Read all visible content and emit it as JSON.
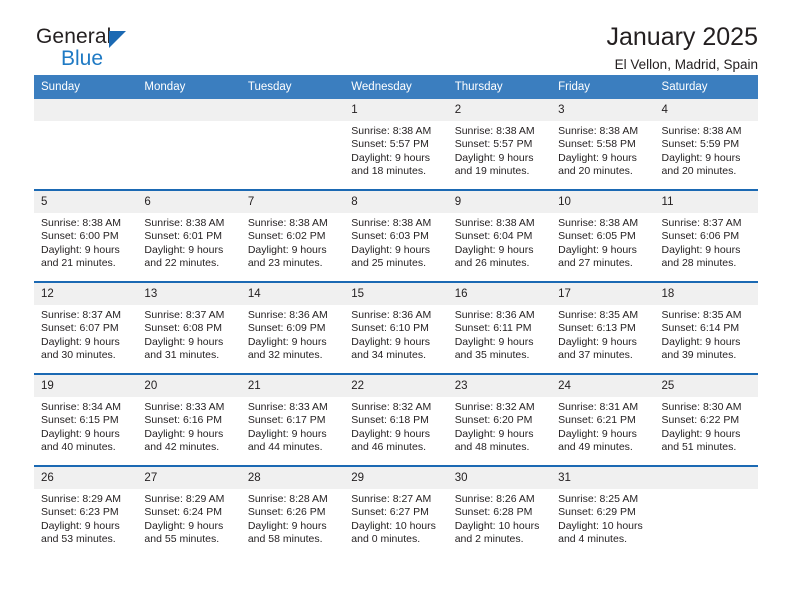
{
  "brand": {
    "line1": "General",
    "line2": "Blue",
    "triangle_color": "#1b69b3",
    "blue_color": "#1f7ac4"
  },
  "header": {
    "title": "January 2025",
    "subtitle": "El Vellon, Madrid, Spain"
  },
  "theme": {
    "header_bg": "#3b7ebf",
    "row_rule": "#1b69b3",
    "daynum_bg": "#f0f0f0",
    "text": "#231f20"
  },
  "weekdays": [
    "Sunday",
    "Monday",
    "Tuesday",
    "Wednesday",
    "Thursday",
    "Friday",
    "Saturday"
  ],
  "weeks": [
    [
      {
        "day": "",
        "sunrise": "",
        "sunset": "",
        "daylight_line1": "",
        "daylight_line2": ""
      },
      {
        "day": "",
        "sunrise": "",
        "sunset": "",
        "daylight_line1": "",
        "daylight_line2": ""
      },
      {
        "day": "",
        "sunrise": "",
        "sunset": "",
        "daylight_line1": "",
        "daylight_line2": ""
      },
      {
        "day": "1",
        "sunrise": "Sunrise: 8:38 AM",
        "sunset": "Sunset: 5:57 PM",
        "daylight_line1": "Daylight: 9 hours",
        "daylight_line2": "and 18 minutes."
      },
      {
        "day": "2",
        "sunrise": "Sunrise: 8:38 AM",
        "sunset": "Sunset: 5:57 PM",
        "daylight_line1": "Daylight: 9 hours",
        "daylight_line2": "and 19 minutes."
      },
      {
        "day": "3",
        "sunrise": "Sunrise: 8:38 AM",
        "sunset": "Sunset: 5:58 PM",
        "daylight_line1": "Daylight: 9 hours",
        "daylight_line2": "and 20 minutes."
      },
      {
        "day": "4",
        "sunrise": "Sunrise: 8:38 AM",
        "sunset": "Sunset: 5:59 PM",
        "daylight_line1": "Daylight: 9 hours",
        "daylight_line2": "and 20 minutes."
      }
    ],
    [
      {
        "day": "5",
        "sunrise": "Sunrise: 8:38 AM",
        "sunset": "Sunset: 6:00 PM",
        "daylight_line1": "Daylight: 9 hours",
        "daylight_line2": "and 21 minutes."
      },
      {
        "day": "6",
        "sunrise": "Sunrise: 8:38 AM",
        "sunset": "Sunset: 6:01 PM",
        "daylight_line1": "Daylight: 9 hours",
        "daylight_line2": "and 22 minutes."
      },
      {
        "day": "7",
        "sunrise": "Sunrise: 8:38 AM",
        "sunset": "Sunset: 6:02 PM",
        "daylight_line1": "Daylight: 9 hours",
        "daylight_line2": "and 23 minutes."
      },
      {
        "day": "8",
        "sunrise": "Sunrise: 8:38 AM",
        "sunset": "Sunset: 6:03 PM",
        "daylight_line1": "Daylight: 9 hours",
        "daylight_line2": "and 25 minutes."
      },
      {
        "day": "9",
        "sunrise": "Sunrise: 8:38 AM",
        "sunset": "Sunset: 6:04 PM",
        "daylight_line1": "Daylight: 9 hours",
        "daylight_line2": "and 26 minutes."
      },
      {
        "day": "10",
        "sunrise": "Sunrise: 8:38 AM",
        "sunset": "Sunset: 6:05 PM",
        "daylight_line1": "Daylight: 9 hours",
        "daylight_line2": "and 27 minutes."
      },
      {
        "day": "11",
        "sunrise": "Sunrise: 8:37 AM",
        "sunset": "Sunset: 6:06 PM",
        "daylight_line1": "Daylight: 9 hours",
        "daylight_line2": "and 28 minutes."
      }
    ],
    [
      {
        "day": "12",
        "sunrise": "Sunrise: 8:37 AM",
        "sunset": "Sunset: 6:07 PM",
        "daylight_line1": "Daylight: 9 hours",
        "daylight_line2": "and 30 minutes."
      },
      {
        "day": "13",
        "sunrise": "Sunrise: 8:37 AM",
        "sunset": "Sunset: 6:08 PM",
        "daylight_line1": "Daylight: 9 hours",
        "daylight_line2": "and 31 minutes."
      },
      {
        "day": "14",
        "sunrise": "Sunrise: 8:36 AM",
        "sunset": "Sunset: 6:09 PM",
        "daylight_line1": "Daylight: 9 hours",
        "daylight_line2": "and 32 minutes."
      },
      {
        "day": "15",
        "sunrise": "Sunrise: 8:36 AM",
        "sunset": "Sunset: 6:10 PM",
        "daylight_line1": "Daylight: 9 hours",
        "daylight_line2": "and 34 minutes."
      },
      {
        "day": "16",
        "sunrise": "Sunrise: 8:36 AM",
        "sunset": "Sunset: 6:11 PM",
        "daylight_line1": "Daylight: 9 hours",
        "daylight_line2": "and 35 minutes."
      },
      {
        "day": "17",
        "sunrise": "Sunrise: 8:35 AM",
        "sunset": "Sunset: 6:13 PM",
        "daylight_line1": "Daylight: 9 hours",
        "daylight_line2": "and 37 minutes."
      },
      {
        "day": "18",
        "sunrise": "Sunrise: 8:35 AM",
        "sunset": "Sunset: 6:14 PM",
        "daylight_line1": "Daylight: 9 hours",
        "daylight_line2": "and 39 minutes."
      }
    ],
    [
      {
        "day": "19",
        "sunrise": "Sunrise: 8:34 AM",
        "sunset": "Sunset: 6:15 PM",
        "daylight_line1": "Daylight: 9 hours",
        "daylight_line2": "and 40 minutes."
      },
      {
        "day": "20",
        "sunrise": "Sunrise: 8:33 AM",
        "sunset": "Sunset: 6:16 PM",
        "daylight_line1": "Daylight: 9 hours",
        "daylight_line2": "and 42 minutes."
      },
      {
        "day": "21",
        "sunrise": "Sunrise: 8:33 AM",
        "sunset": "Sunset: 6:17 PM",
        "daylight_line1": "Daylight: 9 hours",
        "daylight_line2": "and 44 minutes."
      },
      {
        "day": "22",
        "sunrise": "Sunrise: 8:32 AM",
        "sunset": "Sunset: 6:18 PM",
        "daylight_line1": "Daylight: 9 hours",
        "daylight_line2": "and 46 minutes."
      },
      {
        "day": "23",
        "sunrise": "Sunrise: 8:32 AM",
        "sunset": "Sunset: 6:20 PM",
        "daylight_line1": "Daylight: 9 hours",
        "daylight_line2": "and 48 minutes."
      },
      {
        "day": "24",
        "sunrise": "Sunrise: 8:31 AM",
        "sunset": "Sunset: 6:21 PM",
        "daylight_line1": "Daylight: 9 hours",
        "daylight_line2": "and 49 minutes."
      },
      {
        "day": "25",
        "sunrise": "Sunrise: 8:30 AM",
        "sunset": "Sunset: 6:22 PM",
        "daylight_line1": "Daylight: 9 hours",
        "daylight_line2": "and 51 minutes."
      }
    ],
    [
      {
        "day": "26",
        "sunrise": "Sunrise: 8:29 AM",
        "sunset": "Sunset: 6:23 PM",
        "daylight_line1": "Daylight: 9 hours",
        "daylight_line2": "and 53 minutes."
      },
      {
        "day": "27",
        "sunrise": "Sunrise: 8:29 AM",
        "sunset": "Sunset: 6:24 PM",
        "daylight_line1": "Daylight: 9 hours",
        "daylight_line2": "and 55 minutes."
      },
      {
        "day": "28",
        "sunrise": "Sunrise: 8:28 AM",
        "sunset": "Sunset: 6:26 PM",
        "daylight_line1": "Daylight: 9 hours",
        "daylight_line2": "and 58 minutes."
      },
      {
        "day": "29",
        "sunrise": "Sunrise: 8:27 AM",
        "sunset": "Sunset: 6:27 PM",
        "daylight_line1": "Daylight: 10 hours",
        "daylight_line2": "and 0 minutes."
      },
      {
        "day": "30",
        "sunrise": "Sunrise: 8:26 AM",
        "sunset": "Sunset: 6:28 PM",
        "daylight_line1": "Daylight: 10 hours",
        "daylight_line2": "and 2 minutes."
      },
      {
        "day": "31",
        "sunrise": "Sunrise: 8:25 AM",
        "sunset": "Sunset: 6:29 PM",
        "daylight_line1": "Daylight: 10 hours",
        "daylight_line2": "and 4 minutes."
      },
      {
        "day": "",
        "sunrise": "",
        "sunset": "",
        "daylight_line1": "",
        "daylight_line2": ""
      }
    ]
  ]
}
